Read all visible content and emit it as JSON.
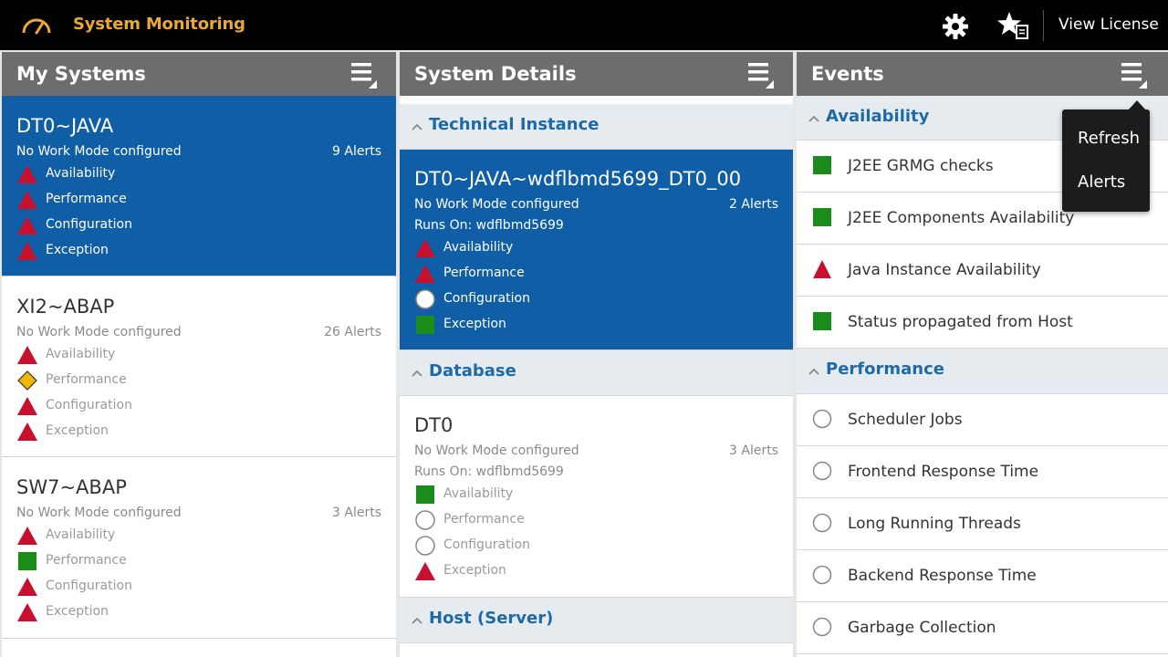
{
  "topbar": {
    "title": "System Monitoring",
    "license_label": "View License",
    "icons": [
      "speedometer-icon",
      "gear-icon",
      "favorites-icon"
    ]
  },
  "panels": {
    "my_systems": {
      "title": "My Systems",
      "systems": [
        {
          "name": "DT0~JAVA",
          "mode": "No Work Mode configured",
          "alerts": "9 Alerts",
          "statuses": [
            {
              "label": "Availability",
              "icon": "red-triangle"
            },
            {
              "label": "Performance",
              "icon": "red-triangle"
            },
            {
              "label": "Configuration",
              "icon": "red-triangle"
            },
            {
              "label": "Exception",
              "icon": "red-triangle"
            }
          ]
        },
        {
          "name": "XI2~ABAP",
          "mode": "No Work Mode configured",
          "alerts": "26 Alerts",
          "statuses": [
            {
              "label": "Availability",
              "icon": "red-triangle"
            },
            {
              "label": "Performance",
              "icon": "yellow-diamond"
            },
            {
              "label": "Configuration",
              "icon": "red-triangle"
            },
            {
              "label": "Exception",
              "icon": "red-triangle"
            }
          ]
        },
        {
          "name": "SW7~ABAP",
          "mode": "No Work Mode configured",
          "alerts": "3 Alerts",
          "statuses": [
            {
              "label": "Availability",
              "icon": "red-triangle"
            },
            {
              "label": "Performance",
              "icon": "green-square"
            },
            {
              "label": "Configuration",
              "icon": "red-triangle"
            },
            {
              "label": "Exception",
              "icon": "red-triangle"
            }
          ]
        }
      ]
    },
    "system_details": {
      "title": "System Details",
      "sections": [
        {
          "label": "Technical Instance"
        },
        {
          "label": "Database"
        },
        {
          "label": "Host (Server)"
        }
      ],
      "instance": {
        "name": "DT0~JAVA~wdflbmd5699_DT0_00",
        "mode": "No Work Mode configured",
        "alerts": "2 Alerts",
        "runs_on": "Runs On: wdflbmd5699",
        "statuses": [
          {
            "label": "Availability",
            "icon": "red-triangle"
          },
          {
            "label": "Performance",
            "icon": "red-triangle"
          },
          {
            "label": "Configuration",
            "icon": "grey-circle"
          },
          {
            "label": "Exception",
            "icon": "green-square"
          }
        ]
      },
      "database": {
        "name": "DT0",
        "mode": "No Work Mode configured",
        "alerts": "3 Alerts",
        "runs_on": "Runs On: wdflbmd5699",
        "statuses": [
          {
            "label": "Availability",
            "icon": "green-square"
          },
          {
            "label": "Performance",
            "icon": "grey-circle"
          },
          {
            "label": "Configuration",
            "icon": "grey-circle"
          },
          {
            "label": "Exception",
            "icon": "red-triangle"
          }
        ]
      }
    },
    "events": {
      "title": "Events",
      "sections": [
        {
          "label": "Availability",
          "items": [
            {
              "label": "J2EE GRMG checks",
              "icon": "green-square"
            },
            {
              "label": "J2EE Components Availability",
              "icon": "green-square"
            },
            {
              "label": "Java Instance Availability",
              "icon": "red-triangle"
            },
            {
              "label": "Status propagated from Host",
              "icon": "green-square"
            }
          ]
        },
        {
          "label": "Performance",
          "items": [
            {
              "label": "Scheduler Jobs",
              "icon": "grey-circle"
            },
            {
              "label": "Frontend Response Time",
              "icon": "grey-circle"
            },
            {
              "label": "Long Running Threads",
              "icon": "grey-circle"
            },
            {
              "label": "Backend Response Time",
              "icon": "grey-circle"
            },
            {
              "label": "Garbage Collection",
              "icon": "grey-circle"
            }
          ]
        }
      ]
    }
  },
  "popup_menu": {
    "items": [
      {
        "label": "Refresh"
      },
      {
        "label": "Alerts"
      }
    ]
  },
  "colors": {
    "accent_blue": "#0f5ea6",
    "section_text": "#1e6aa8",
    "header_grey": "#6d6d6d",
    "status_red": "#c8102e",
    "status_green": "#1a8c1a",
    "status_yellow": "#f2b705",
    "title_orange": "#e8a83a"
  }
}
